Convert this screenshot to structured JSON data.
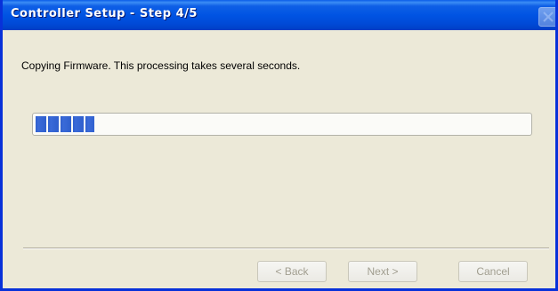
{
  "window": {
    "title": "Controller Setup - Step 4/5",
    "close_label": "✕"
  },
  "content": {
    "message": "Copying Firmware. This processing takes several seconds.",
    "progress_fraction": 0.12
  },
  "buttons": {
    "back_label": "< Back",
    "next_label": "Next >",
    "cancel_label": "Cancel"
  },
  "colors": {
    "titlebar": "#0054e3",
    "progress_block": "#2f5fcd",
    "window_bg": "#ece9d8"
  },
  "icons": {
    "close": "close-icon"
  }
}
